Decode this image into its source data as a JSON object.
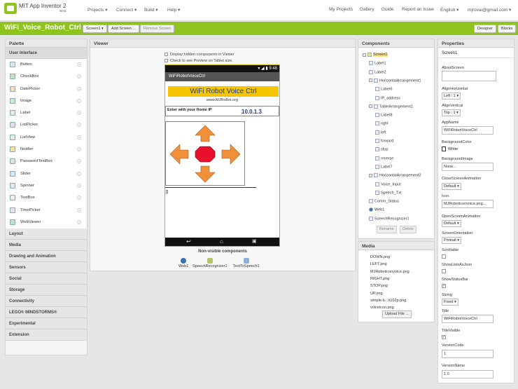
{
  "app": {
    "title": "MIT App Inventor 2",
    "subtitle": "Beta"
  },
  "topnav": {
    "projects": "Projects ▾",
    "connect": "Connect ▾",
    "build": "Build ▾",
    "help": "Help ▾",
    "my_projects": "My Projects",
    "gallery": "Gallery",
    "guide": "Guide",
    "report": "Report an Issue",
    "language": "English ▾",
    "user": "mjrovai@gmail.com ▾"
  },
  "toolbar": {
    "project_name": "WiFi_Voice_Robot_Ctrl",
    "screen_select": "Screen1 ▾",
    "add_screen": "Add Screen ...",
    "remove_screen": "Remove Screen",
    "designer": "Designer",
    "blocks": "Blocks"
  },
  "palette": {
    "header": "Palette",
    "category_active": "User Interface",
    "items": [
      "Button",
      "CheckBox",
      "DatePicker",
      "Image",
      "Label",
      "ListPicker",
      "ListView",
      "Notifier",
      "PasswordTextBox",
      "Slider",
      "Spinner",
      "TextBox",
      "TimePicker",
      "WebViewer"
    ],
    "categories": [
      "Layout",
      "Media",
      "Drawing and Animation",
      "Sensors",
      "Social",
      "Storage",
      "Connectivity",
      "LEGO® MINDSTORMS®",
      "Experimental",
      "Extension"
    ]
  },
  "viewer": {
    "header": "Viewer",
    "hidden_check": "Display hidden components in Viewer",
    "tablet_check": "Check to see Preview on Tablet size.",
    "status_time": "9:48",
    "screen_title": "WiFiRobotVoiceCtrl",
    "app_title": "WiFi Robot Voice Ctrl",
    "url": "www.MJRoBot.org",
    "ip_label": "Enter with your Home IP",
    "ip_value": "10.0.1.3",
    "nonvisible_header": "Non-visible components",
    "nonvisible": [
      "Web1",
      "SpeechRecognizer1",
      "TextToSpeech1"
    ]
  },
  "components": {
    "header": "Components",
    "tree": [
      "Screen1",
      "Label1",
      "Label2",
      "HorizontalArrangement1",
      "Label6",
      "IP_address",
      "TableArrangement1",
      "Label8",
      "right",
      "left",
      "forward",
      "stop",
      "reverse",
      "Label7",
      "HorizontalArrangement2",
      "Voice_Input",
      "Speech_Txt",
      "Comm_Status",
      "Web1",
      "SoeechRecognizer1"
    ],
    "rename": "Rename",
    "delete": "Delete"
  },
  "media": {
    "header": "Media",
    "files": [
      "DOWN.png",
      "LEFT.png",
      "MJRoboticonvoice.png",
      "RIGHT.png",
      "STOP.png",
      "UP.png",
      "simple-b...h102p.png",
      "voiceicon.png"
    ],
    "upload": "Upload File ..."
  },
  "properties": {
    "header": "Properties",
    "component": "Screen1",
    "about_label": "AboutScreen",
    "align_h_label": "AlignHorizontal",
    "align_h_value": "Left : 1 ▾",
    "align_v_label": "AlignVertical",
    "align_v_value": "Top : 1 ▾",
    "appname_label": "AppName",
    "appname_value": "WiFiRobotVoiceCtrl",
    "bgcolor_label": "BackgroundColor",
    "bgcolor_value": "White",
    "bgimage_label": "BackgroundImage",
    "bgimage_value": "None...",
    "close_anim_label": "CloseScreenAnimation",
    "close_anim_value": "Default ▾",
    "icon_label": "Icon",
    "icon_value": "MJRoboticonvoice.png...",
    "open_anim_label": "OpenScreenAnimation",
    "open_anim_value": "Default ▾",
    "orientation_label": "ScreenOrientation",
    "orientation_value": "Portrait ▾",
    "scrollable_label": "Scrollable",
    "showlists_label": "ShowListsAsJson",
    "statusbar_label": "ShowStatusBar",
    "sizing_label": "Sizing",
    "sizing_value": "Fixed ▾",
    "title_label": "Title",
    "title_value": "WiFiRobotVoiceCtrl",
    "titlevisible_label": "TitleVisible",
    "vcode_label": "VersionCode",
    "vcode_value": "1",
    "vname_label": "VersionName",
    "vname_value": "1.0"
  },
  "colors": {
    "brand_green": "#8fc31f",
    "arrow_orange": "#f0903a",
    "stop_red": "#e8102a",
    "banner_yellow": "#f6c500"
  }
}
